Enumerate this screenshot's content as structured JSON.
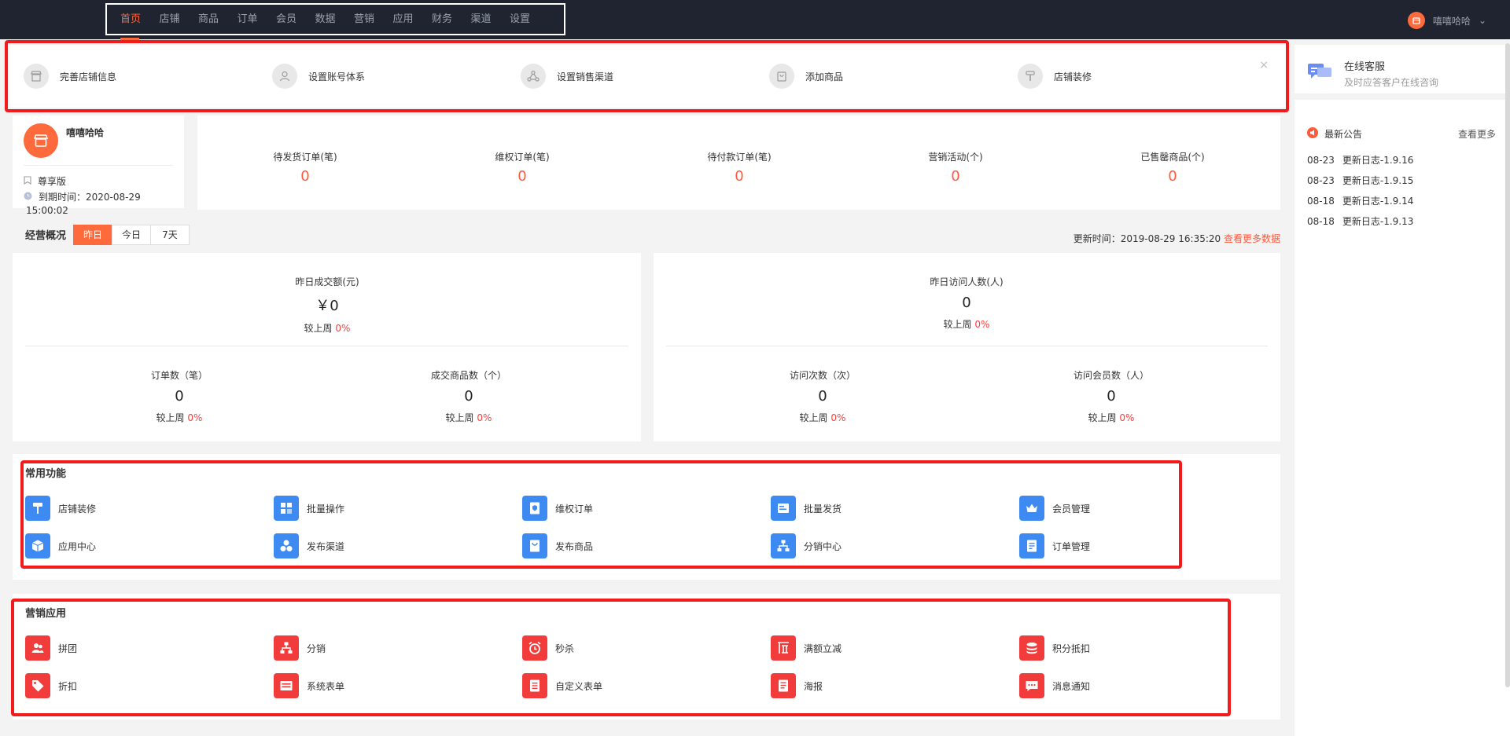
{
  "nav": {
    "items": [
      "首页",
      "店铺",
      "商品",
      "订单",
      "会员",
      "数据",
      "营销",
      "应用",
      "财务",
      "渠道",
      "设置"
    ],
    "user_name": "嘻嘻哈哈"
  },
  "guide": {
    "items": [
      "完善店铺信息",
      "设置账号体系",
      "设置销售渠道",
      "添加商品",
      "店铺装修"
    ],
    "close": "×"
  },
  "service": {
    "title": "在线客服",
    "subtitle": "及时应答客户在线咨询"
  },
  "notice": {
    "title": "最新公告",
    "more": "查看更多",
    "items": [
      {
        "date": "08-23",
        "text": "更新日志-1.9.16"
      },
      {
        "date": "08-23",
        "text": "更新日志-1.9.15"
      },
      {
        "date": "08-18",
        "text": "更新日志-1.9.14"
      },
      {
        "date": "08-18",
        "text": "更新日志-1.9.13"
      }
    ]
  },
  "shop": {
    "name": "嘻嘻哈哈",
    "edition": "尊享版",
    "expire_line1": "到期时间：2020-08-29",
    "expire_line2": "15:00:02"
  },
  "stats": [
    {
      "label": "待发货订单(笔)",
      "value": "0"
    },
    {
      "label": "维权订单(笔)",
      "value": "0"
    },
    {
      "label": "待付款订单(笔)",
      "value": "0"
    },
    {
      "label": "营销活动(个)",
      "value": "0"
    },
    {
      "label": "已售罄商品(个)",
      "value": "0"
    }
  ],
  "overview": {
    "title": "经营概况",
    "tabs": [
      "昨日",
      "今日",
      "7天"
    ],
    "update_time": "更新时间：2019-08-29 16:35:20",
    "more_link": "查看更多数据",
    "compare_label": "较上周",
    "left": {
      "main": {
        "label": "昨日成交额(元)",
        "value": "￥0",
        "pct": "0%"
      },
      "sub1": {
        "label": "订单数（笔）",
        "value": "0",
        "pct": "0%"
      },
      "sub2": {
        "label": "成交商品数（个）",
        "value": "0",
        "pct": "0%"
      }
    },
    "right": {
      "main": {
        "label": "昨日访问人数(人)",
        "value": "0",
        "pct": "0%"
      },
      "sub1": {
        "label": "访问次数（次）",
        "value": "0",
        "pct": "0%"
      },
      "sub2": {
        "label": "访问会员数（人）",
        "value": "0",
        "pct": "0%"
      }
    }
  },
  "common": {
    "title": "常用功能",
    "items": [
      "店铺装修",
      "批量操作",
      "维权订单",
      "批量发货",
      "会员管理",
      "应用中心",
      "发布渠道",
      "发布商品",
      "分销中心",
      "订单管理"
    ],
    "icons": [
      "paint-roller-icon",
      "batch-grid-icon",
      "rights-order-icon",
      "batch-ship-icon",
      "crown-icon",
      "cube-icon",
      "channel-icon",
      "publish-product-icon",
      "distribution-icon",
      "order-list-icon"
    ]
  },
  "marketing": {
    "title": "营销应用",
    "items": [
      "拼团",
      "分销",
      "秒杀",
      "满额立减",
      "积分抵扣",
      "折扣",
      "系统表单",
      "自定义表单",
      "海报",
      "消息通知"
    ],
    "icons": [
      "group-buy-icon",
      "distribution-icon",
      "alarm-clock-icon",
      "full-reduction-icon",
      "points-coin-icon",
      "discount-tag-icon",
      "system-form-icon",
      "custom-form-icon",
      "poster-icon",
      "message-icon"
    ]
  },
  "colors": {
    "accent": "#ff6a3c",
    "highlight_box": "#f21a1a",
    "feature_blue": "#3d8bf2",
    "feature_red": "#f23c3c",
    "topbar": "#1f2430"
  }
}
